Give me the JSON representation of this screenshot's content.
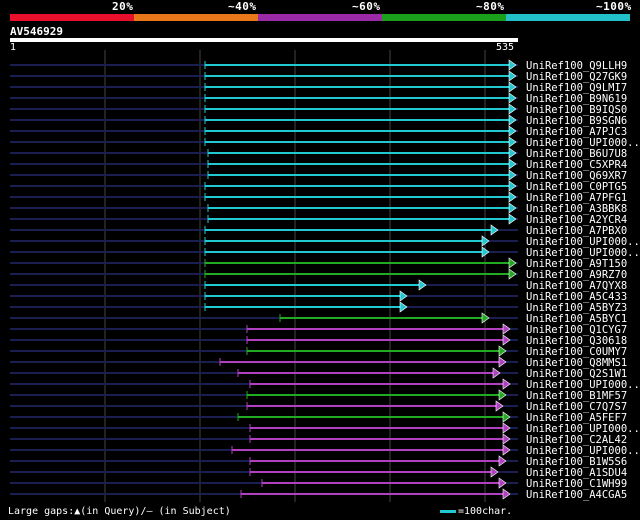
{
  "query": {
    "id": "AV546929",
    "start_label": "1",
    "end_label": "535"
  },
  "scale": {
    "ticks": [
      {
        "label": "20%",
        "color": "#e8102a"
      },
      {
        "label": "~40%",
        "color": "#e8781a"
      },
      {
        "label": "~60%",
        "color": "#9a2aa6"
      },
      {
        "label": "~80%",
        "color": "#1aa01a"
      },
      {
        "label": "~100%",
        "color": "#22c0c8"
      }
    ]
  },
  "colors": {
    "cyan": "#22c8d0",
    "green": "#22aa22",
    "magenta": "#b040c0",
    "gap": "#1a1e50",
    "grid": "#444"
  },
  "hits": [
    {
      "name": "UniRef100_Q9LLH9",
      "color": "cyan",
      "start": 205,
      "end": 515
    },
    {
      "name": "UniRef100_Q27GK9",
      "color": "cyan",
      "start": 205,
      "end": 515
    },
    {
      "name": "UniRef100_Q9LMI7",
      "color": "cyan",
      "start": 205,
      "end": 515
    },
    {
      "name": "UniRef100_B9N619",
      "color": "cyan",
      "start": 205,
      "end": 515
    },
    {
      "name": "UniRef100_B9IQS0",
      "color": "cyan",
      "start": 205,
      "end": 515
    },
    {
      "name": "UniRef100_B9SGN6",
      "color": "cyan",
      "start": 205,
      "end": 515
    },
    {
      "name": "UniRef100_A7PJC3",
      "color": "cyan",
      "start": 205,
      "end": 515
    },
    {
      "name": "UniRef100_UPI000..",
      "color": "cyan",
      "start": 205,
      "end": 515
    },
    {
      "name": "UniRef100_B6U7U8",
      "color": "cyan",
      "start": 208,
      "end": 515
    },
    {
      "name": "UniRef100_C5XPR4",
      "color": "cyan",
      "start": 208,
      "end": 515
    },
    {
      "name": "UniRef100_Q69XR7",
      "color": "cyan",
      "start": 208,
      "end": 515
    },
    {
      "name": "UniRef100_C0PTG5",
      "color": "cyan",
      "start": 205,
      "end": 515
    },
    {
      "name": "UniRef100_A7PFG1",
      "color": "cyan",
      "start": 205,
      "end": 515
    },
    {
      "name": "UniRef100_A3BBK8",
      "color": "cyan",
      "start": 208,
      "end": 515
    },
    {
      "name": "UniRef100_A2YCR4",
      "color": "cyan",
      "start": 208,
      "end": 515
    },
    {
      "name": "UniRef100_A7PBX0",
      "color": "cyan",
      "start": 205,
      "end": 497
    },
    {
      "name": "UniRef100_UPI000..",
      "color": "cyan",
      "start": 205,
      "end": 488
    },
    {
      "name": "UniRef100_UPI000..",
      "color": "cyan",
      "start": 205,
      "end": 488
    },
    {
      "name": "UniRef100_A9T150",
      "color": "green",
      "start": 205,
      "end": 515
    },
    {
      "name": "UniRef100_A9RZ70",
      "color": "green",
      "start": 205,
      "end": 515
    },
    {
      "name": "UniRef100_A7QYX8",
      "color": "cyan",
      "start": 205,
      "end": 425
    },
    {
      "name": "UniRef100_A5C433",
      "color": "cyan",
      "start": 205,
      "end": 406
    },
    {
      "name": "UniRef100_A5BYZ3",
      "color": "cyan",
      "start": 205,
      "end": 406
    },
    {
      "name": "UniRef100_A5BYC1",
      "color": "green",
      "start": 280,
      "end": 488
    },
    {
      "name": "UniRef100_Q1CYG7",
      "color": "magenta",
      "start": 247,
      "end": 509
    },
    {
      "name": "UniRef100_Q30618",
      "color": "magenta",
      "start": 247,
      "end": 509
    },
    {
      "name": "UniRef100_C0UMY7",
      "color": "green",
      "start": 247,
      "end": 505
    },
    {
      "name": "UniRef100_Q8MMS1",
      "color": "magenta",
      "start": 220,
      "end": 505
    },
    {
      "name": "UniRef100_Q2S1W1",
      "color": "magenta",
      "start": 238,
      "end": 499
    },
    {
      "name": "UniRef100_UPI000..",
      "color": "magenta",
      "start": 250,
      "end": 509
    },
    {
      "name": "UniRef100_B1MF57",
      "color": "green",
      "start": 247,
      "end": 505
    },
    {
      "name": "UniRef100_C7Q7S7",
      "color": "magenta",
      "start": 247,
      "end": 502
    },
    {
      "name": "UniRef100_A5FEF7",
      "color": "green",
      "start": 238,
      "end": 509
    },
    {
      "name": "UniRef100_UPI000..",
      "color": "magenta",
      "start": 250,
      "end": 509
    },
    {
      "name": "UniRef100_C2AL42",
      "color": "magenta",
      "start": 250,
      "end": 509
    },
    {
      "name": "UniRef100_UPI000..",
      "color": "magenta",
      "start": 232,
      "end": 509
    },
    {
      "name": "UniRef100_B1W5S6",
      "color": "magenta",
      "start": 250,
      "end": 505
    },
    {
      "name": "UniRef100_A1SDU4",
      "color": "magenta",
      "start": 250,
      "end": 497
    },
    {
      "name": "UniRef100_C1WH99",
      "color": "magenta",
      "start": 262,
      "end": 505
    },
    {
      "name": "UniRef100_A4CGA5",
      "color": "magenta",
      "start": 241,
      "end": 509
    }
  ],
  "footer": {
    "gaps_text": "Large gaps:▲(in Query)/— (in Subject)",
    "legend_text": "=100char."
  }
}
